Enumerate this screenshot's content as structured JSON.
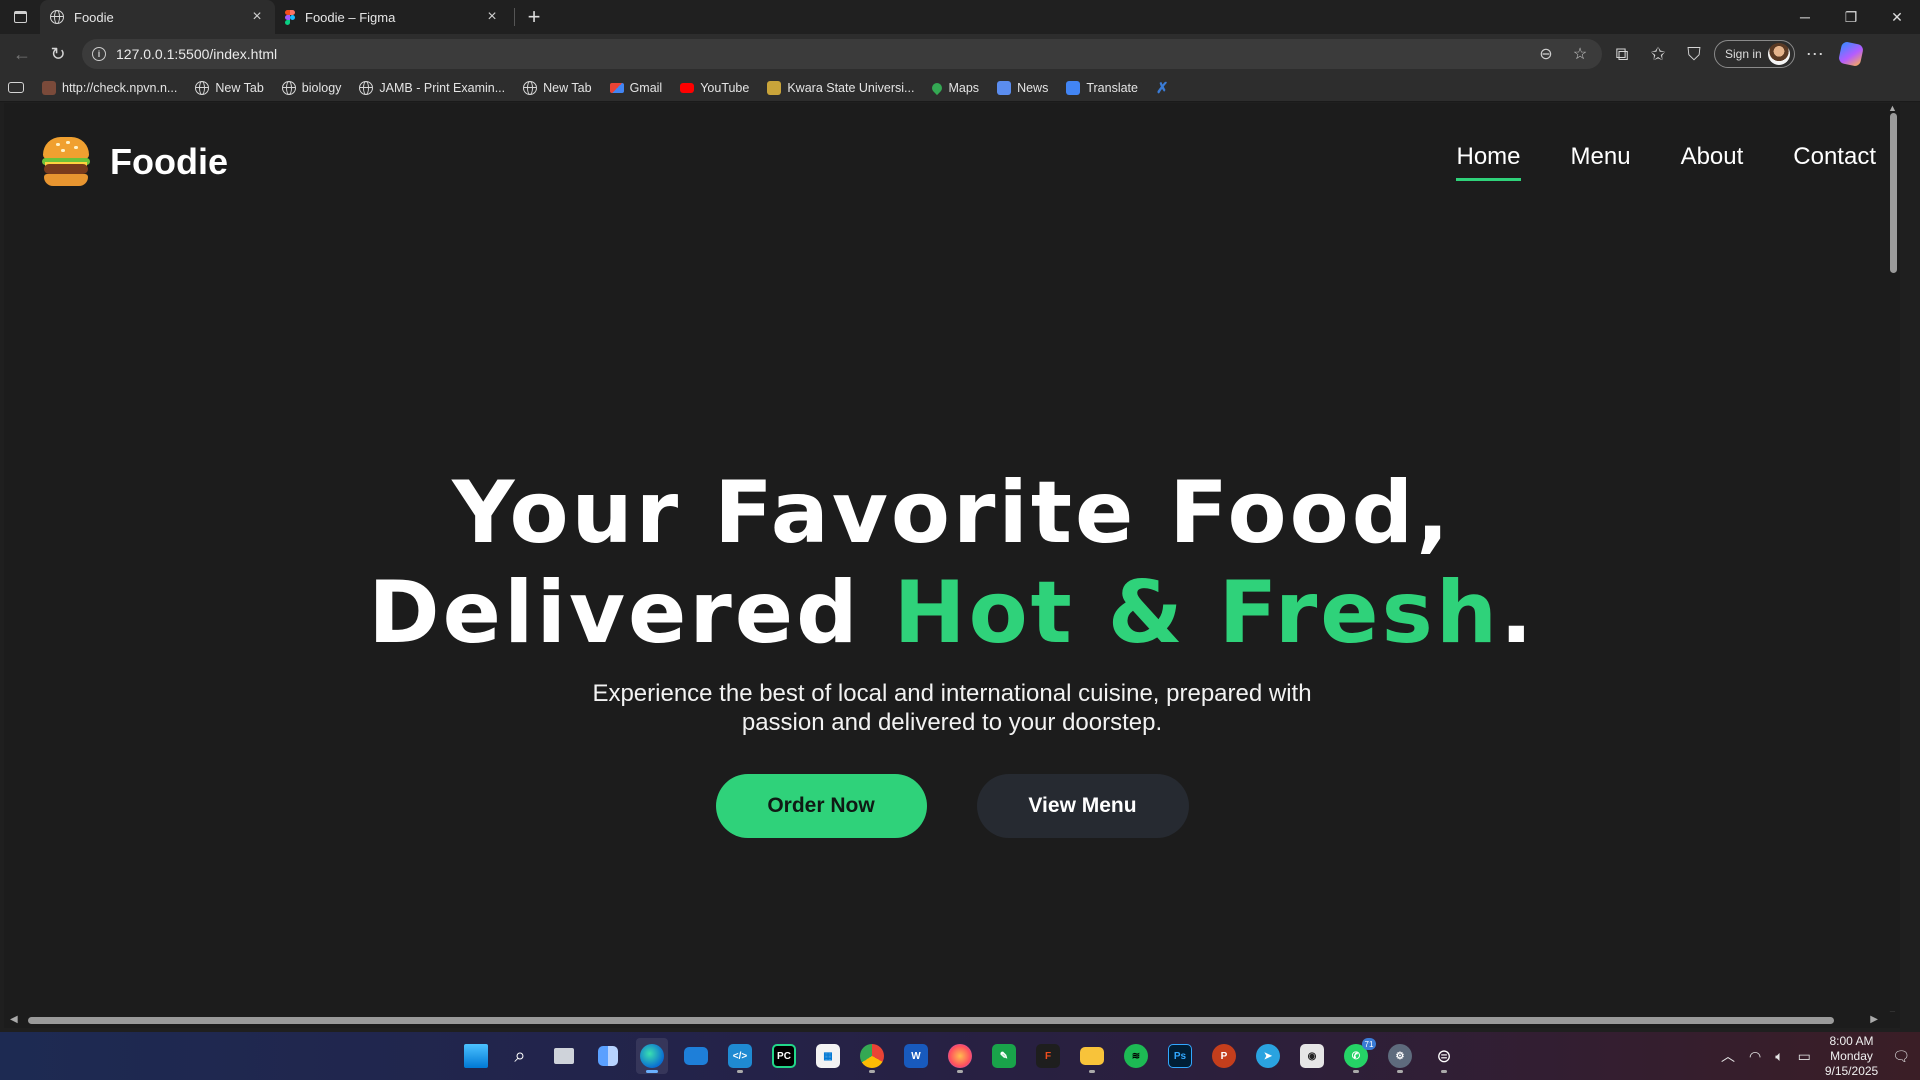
{
  "browser": {
    "tabs": [
      {
        "title": "Foodie",
        "active": true
      },
      {
        "title": "Foodie – Figma",
        "active": false
      }
    ],
    "new_tab_symbol": "+",
    "address": "127.0.0.1:5500/index.html",
    "sign_in_label": "Sign in",
    "bookmarks": [
      {
        "label": "http://check.npvn.n...",
        "icon": "bookmark-favicon-icon"
      },
      {
        "label": "New Tab",
        "icon": "globe-icon"
      },
      {
        "label": "biology",
        "icon": "globe-icon"
      },
      {
        "label": "JAMB - Print Examin...",
        "icon": "globe-icon"
      },
      {
        "label": "New Tab",
        "icon": "globe-icon"
      },
      {
        "label": "Gmail",
        "icon": "gmail-icon"
      },
      {
        "label": "YouTube",
        "icon": "youtube-icon"
      },
      {
        "label": "Kwara State Universi...",
        "icon": "kwasu-icon"
      },
      {
        "label": "Maps",
        "icon": "maps-icon"
      },
      {
        "label": "News",
        "icon": "news-icon"
      },
      {
        "label": "Translate",
        "icon": "translate-icon"
      }
    ]
  },
  "site": {
    "brand": "Foodie",
    "nav": [
      {
        "label": "Home",
        "active": true
      },
      {
        "label": "Menu",
        "active": false
      },
      {
        "label": "About",
        "active": false
      },
      {
        "label": "Contact",
        "active": false
      }
    ],
    "hero": {
      "line1": "Your Favorite Food,",
      "line2_prefix": "Delivered ",
      "line2_accent": "Hot & Fresh",
      "line2_suffix": ".",
      "subtitle": "Experience the best of local and international cuisine, prepared with passion and delivered to your doorstep.",
      "primary_cta": "Order Now",
      "secondary_cta": "View Menu"
    },
    "colors": {
      "accent": "#2fd27a",
      "background": "#1c1c1c",
      "secondary_button": "#262a31"
    }
  },
  "taskbar": {
    "apps": [
      "start-icon",
      "search-icon",
      "task-view-icon",
      "widgets-icon",
      "edge-icon",
      "mail-icon",
      "vscode-icon",
      "pycharm-icon",
      "store-icon",
      "chrome-icon",
      "word-icon",
      "firefox-icon",
      "notepad-icon",
      "figma-icon",
      "file-explorer-icon",
      "spotify-icon",
      "photoshop-icon",
      "powerpoint-icon",
      "telegram-icon",
      "terminal-icon",
      "whatsapp-icon",
      "settings-icon",
      "steam-icon"
    ],
    "whatsapp_badge": "71",
    "clock": {
      "time": "8:00 AM",
      "day": "Monday",
      "date": "9/15/2025"
    }
  }
}
